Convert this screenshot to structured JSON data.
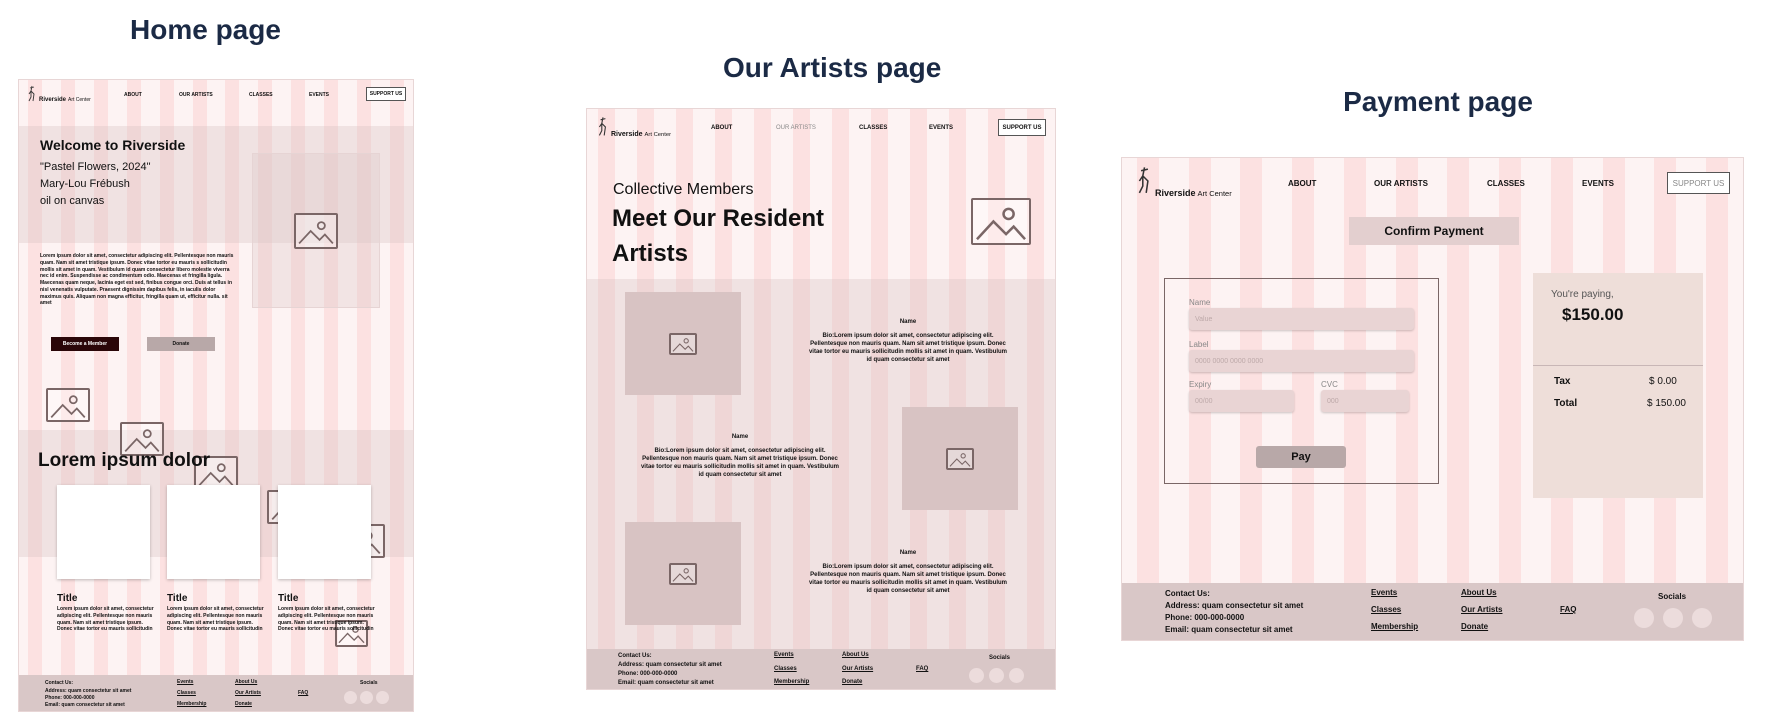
{
  "headings": {
    "home": "Home page",
    "artists": "Our Artists page",
    "payment": "Payment page"
  },
  "nav": {
    "brand": "Riverside",
    "brand_suffix": "Art Center",
    "about": "ABOUT",
    "our_artists": "OUR ARTISTS",
    "classes": "CLASSES",
    "events": "EVENTS",
    "support": "SUPPORT US"
  },
  "home": {
    "hero_title": "Welcome to Riverside",
    "artwork_title": "\"Pastel Flowers, 2024\"",
    "artwork_artist": "Mary-Lou Frébush",
    "artwork_medium": "oil on canvas",
    "body": "Lorem ipsum dolor sit amet, consectetur adipiscing elit. Pellentesque non mauris quam. Nam sit amet tristique ipsum. Donec vitae tortor eu mauris s sollicitudin mollis sit amet in quam. Vestibulum id quam consectetur libero molestie viverra nec id enim. Suspendisse ac condimentum odio. Maecenas et fringilla ligula. Maecenas quam neque, lacinia eget est sed, finibus congue orci. Duis at tellus in nisl venenatis vulputate. Praesent dignissim dapibus felis, in iaculis dolor maximus quis. Aliquam non magna efficitur, fringilla quam ut, efficitur nulla. sit amet",
    "become_member": "Become a Member",
    "donate": "Donate",
    "section_title": "Lorem ipsum dolor",
    "cards": [
      {
        "title": "Title",
        "text": "Lorem ipsum dolor sit amet, consectetur adipiscing elit. Pellentesque non mauris quam. Nam sit amet tristique ipsum. Donec vitae tortor eu mauris sollicitudin"
      },
      {
        "title": "Title",
        "text": "Lorem ipsum dolor sit amet, consectetur adipiscing elit. Pellentesque non mauris quam. Nam sit amet tristique ipsum. Donec vitae tortor eu mauris sollicitudin"
      },
      {
        "title": "Title",
        "text": "Lorem ipsum dolor sit amet, consectetur adipiscing elit. Pellentesque non mauris quam. Nam sit amet tristique ipsum. Donec vitae tortor eu mauris sollicitudin"
      }
    ]
  },
  "artists": {
    "eyebrow": "Collective Members",
    "title_line1": "Meet Our Resident",
    "title_line2": "Artists",
    "members": [
      {
        "name": "Name",
        "bio": "Bio:Lorem ipsum dolor sit amet, consectetur adipiscing elit. Pellentesque non mauris quam. Nam sit amet tristique ipsum. Donec vitae tortor eu mauris sollicitudin mollis sit amet in quam. Vestibulum id quam consectetur sit amet"
      },
      {
        "name": "Name",
        "bio": "Bio:Lorem ipsum dolor sit amet, consectetur adipiscing elit. Pellentesque non mauris quam. Nam sit amet tristique ipsum. Donec vitae tortor eu mauris sollicitudin mollis sit amet in quam. Vestibulum id quam consectetur sit amet"
      },
      {
        "name": "Name",
        "bio": "Bio:Lorem ipsum dolor sit amet, consectetur adipiscing elit. Pellentesque non mauris quam. Nam sit amet tristique ipsum. Donec vitae tortor eu mauris sollicitudin mollis sit amet in quam. Vestibulum id quam consectetur sit amet"
      }
    ]
  },
  "payment": {
    "confirm": "Confirm Payment",
    "name_label": "Name",
    "name_placeholder": "Value",
    "card_label": "Label",
    "card_placeholder": "0000 0000 0000 0000",
    "expiry_label": "Expiry",
    "expiry_placeholder": "00/00",
    "cvc_label": "CVC",
    "cvc_placeholder": "000",
    "pay": "Pay",
    "youre_paying": "You're paying,",
    "amount": "$150.00",
    "tax_label": "Tax",
    "tax_value": "$ 0.00",
    "total_label": "Total",
    "total_value": "$ 150.00"
  },
  "footer": {
    "contact": "Contact Us:",
    "address": "Address: quam consectetur sit amet",
    "phone": "Phone: 000-000-0000",
    "email": "Email: quam consectetur sit amet",
    "events": "Events",
    "classes": "Classes",
    "membership": "Membership",
    "about": "About Us",
    "our_artists": "Our Artists",
    "donate": "Donate",
    "faq": "FAQ",
    "socials": "Socials"
  },
  "colors": {
    "heading": "#1b2a45",
    "frame_bg": "#fdf3f3",
    "column": "#fce1e1",
    "footer_bg": "#d9c7c7",
    "primary_button": "#2a0608",
    "secondary_button": "#b8a8a8"
  }
}
